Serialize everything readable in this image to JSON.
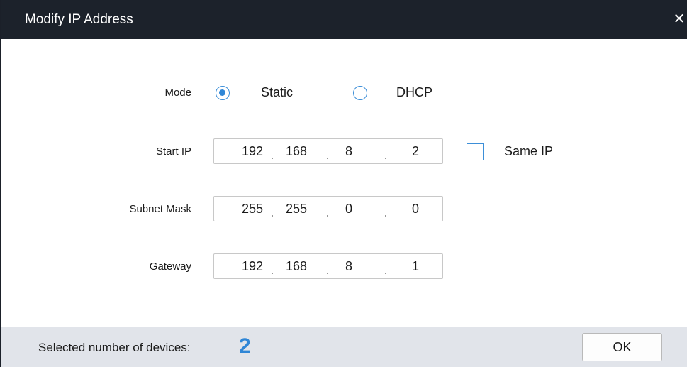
{
  "dialog": {
    "title": "Modify IP Address",
    "close_glyph": "✕"
  },
  "mode": {
    "label": "Mode",
    "options": [
      {
        "label": "Static",
        "selected": true
      },
      {
        "label": "DHCP",
        "selected": false
      }
    ]
  },
  "start_ip": {
    "label": "Start IP",
    "octets": [
      "192",
      "168",
      "8",
      "2"
    ],
    "same_ip_label": "Same IP",
    "same_ip_checked": false
  },
  "subnet_mask": {
    "label": "Subnet Mask",
    "octets": [
      "255",
      "255",
      "0",
      "0"
    ]
  },
  "gateway": {
    "label": "Gateway",
    "octets": [
      "192",
      "168",
      "8",
      "1"
    ]
  },
  "footer": {
    "selected_label": "Selected number of devices:",
    "selected_count": "2",
    "ok_label": "OK"
  },
  "icons": {
    "close": "close-icon",
    "radio": "radio-button-icon",
    "checkbox": "checkbox-icon"
  },
  "colors": {
    "titlebar": "#1c222b",
    "accent": "#2f86d6",
    "footer": "#e1e4ea"
  }
}
